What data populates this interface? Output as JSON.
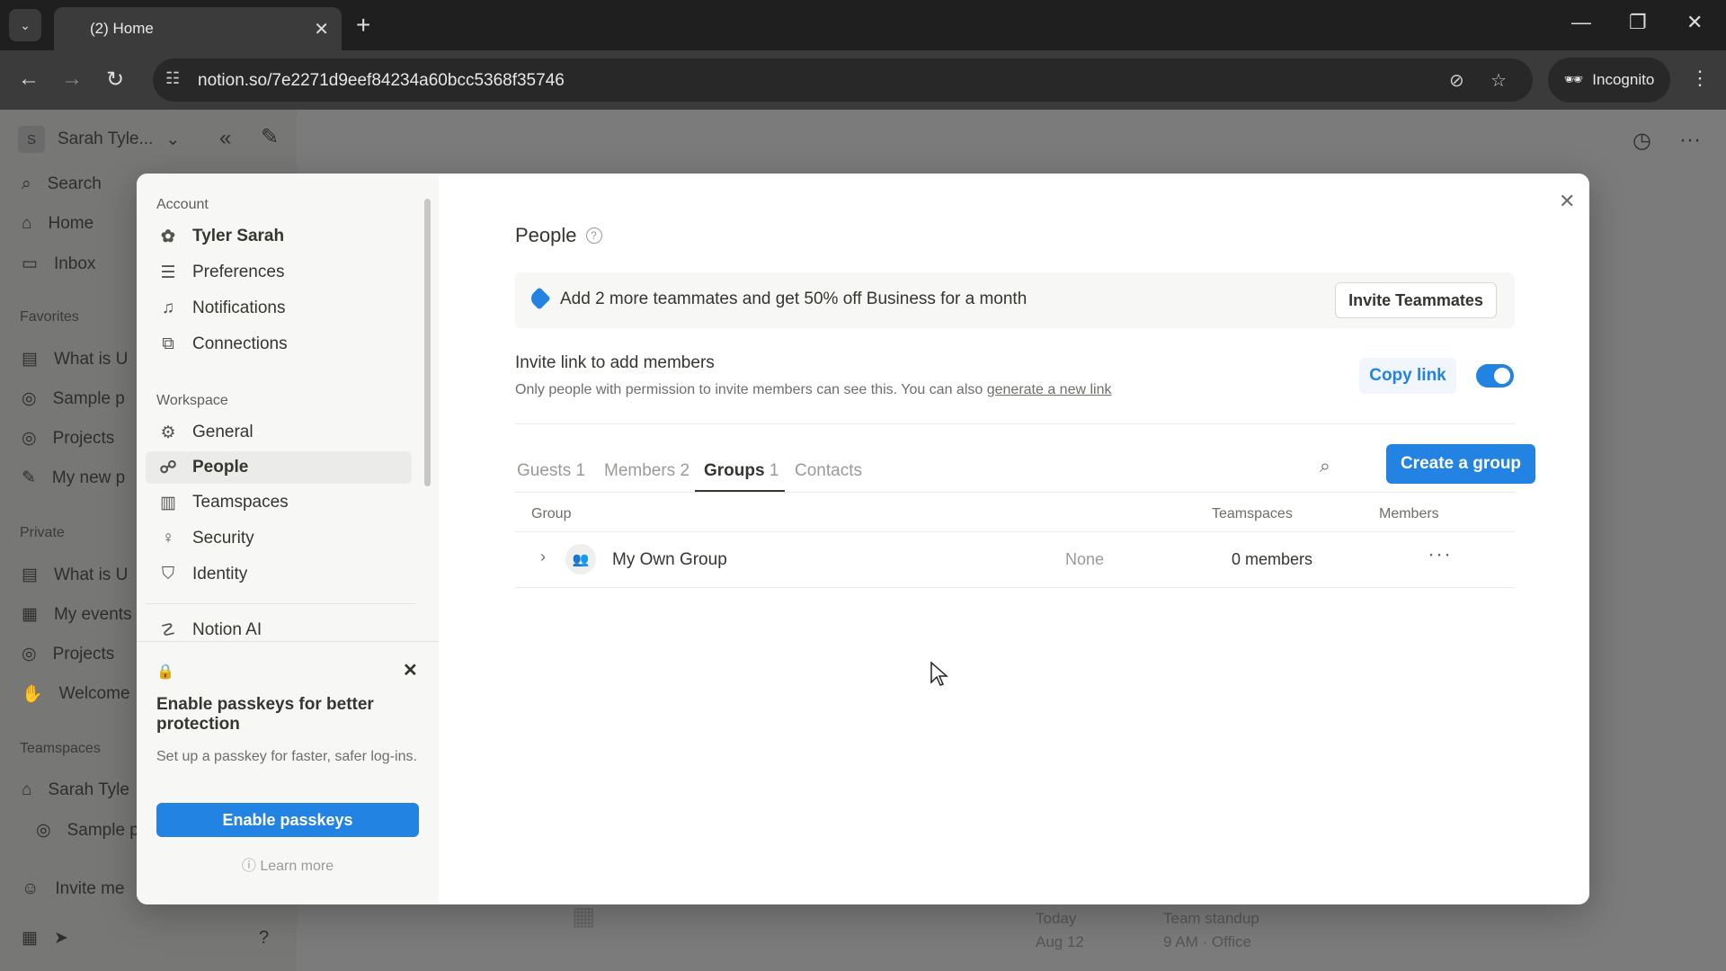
{
  "browser": {
    "tab_title": "(2) Home",
    "url": "notion.so/7e2271d9eef84234a60bcc5368f35746",
    "incognito_label": "Incognito"
  },
  "workspace": {
    "name": "Sarah Tyle...",
    "avatar_letter": "S"
  },
  "sidebar": {
    "search": "Search",
    "home": "Home",
    "inbox": "Inbox",
    "favorites_label": "Favorites",
    "favorites": [
      "What is U",
      "Sample p",
      "Projects",
      "My new p"
    ],
    "private_label": "Private",
    "private": [
      "What is U",
      "My events",
      "Projects",
      "Welcome"
    ],
    "teamspaces_label": "Teamspaces",
    "teamspaces": [
      "Sarah Tyle",
      "Sample p"
    ],
    "invite": "Invite me"
  },
  "background": {
    "event_date_1": "Today",
    "event_date_2": "Aug 12",
    "event_title": "Team standup",
    "event_sub": "9 AM · Office"
  },
  "settings": {
    "account_label": "Account",
    "user_name": "Tyler Sarah",
    "account_items": [
      "Preferences",
      "Notifications",
      "Connections"
    ],
    "workspace_label": "Workspace",
    "workspace_items": [
      "General",
      "People",
      "Teamspaces",
      "Security",
      "Identity"
    ],
    "ai_item": "Notion AI",
    "passkey": {
      "title": "Enable passkeys for better protection",
      "description": "Set up a passkey for faster, safer log-ins.",
      "button": "Enable passkeys",
      "learn_more": "Learn more"
    }
  },
  "people": {
    "title": "People",
    "promo_text": "Add 2 more teammates and get 50% off Business for a month",
    "invite_button": "Invite Teammates",
    "invite_link_title": "Invite link to add members",
    "invite_link_desc": "Only people with permission to invite members can see this. You can also ",
    "generate_link": "generate a new link",
    "copy_link": "Copy link",
    "tabs": [
      {
        "label": "Guests",
        "count": "1"
      },
      {
        "label": "Members",
        "count": "2"
      },
      {
        "label": "Groups",
        "count": "1"
      },
      {
        "label": "Contacts",
        "count": ""
      }
    ],
    "create_group": "Create a group",
    "columns": [
      "Group",
      "Teamspaces",
      "Members"
    ],
    "rows": [
      {
        "name": "My Own Group",
        "teamspaces": "None",
        "members": "0 members"
      }
    ]
  },
  "colors": {
    "accent": "#2383e2"
  }
}
